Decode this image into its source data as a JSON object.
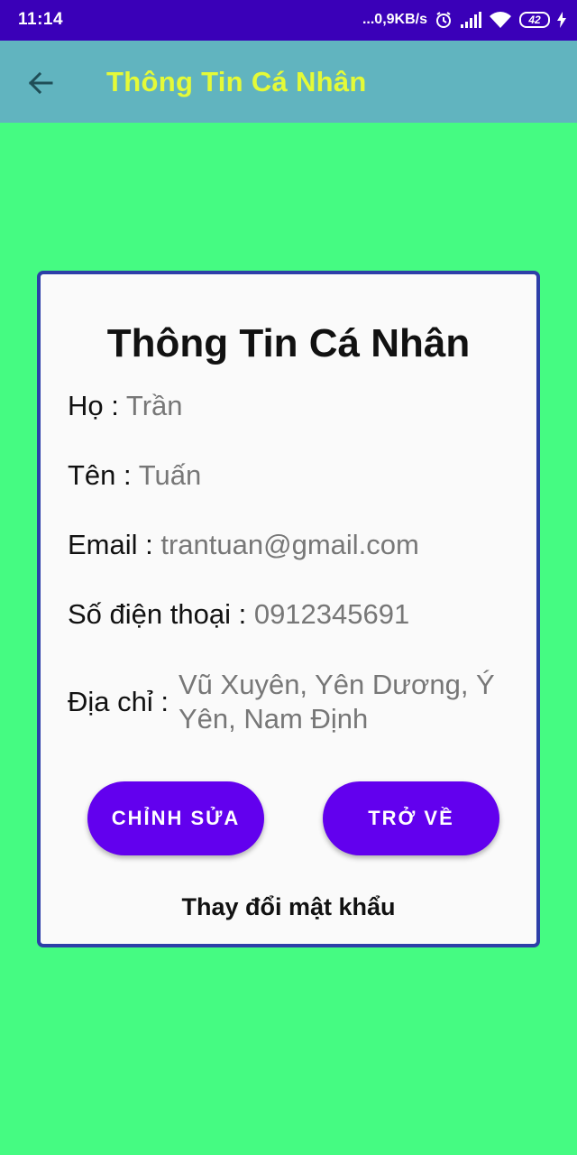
{
  "status_bar": {
    "time": "11:14",
    "network_speed": "...0,9KB/s",
    "battery_level": "42",
    "icons": [
      "alarm-icon",
      "signal-icon",
      "wifi-icon",
      "battery-icon",
      "charging-icon"
    ]
  },
  "app_bar": {
    "title": "Thông Tin Cá Nhân",
    "back_icon": "arrow-left-icon",
    "background": "#61b4bf",
    "title_color": "#e4fa38"
  },
  "card": {
    "title": "Thông Tin Cá Nhân",
    "fields": {
      "last_name": {
        "label": "Họ : ",
        "value": "Trần"
      },
      "first_name": {
        "label": "Tên : ",
        "value": "Tuấn"
      },
      "email": {
        "label": "Email : ",
        "value": "trantuan@gmail.com"
      },
      "phone": {
        "label": "Số điện thoại : ",
        "value": "0912345691"
      },
      "address": {
        "label": "Địa chỉ :",
        "value": "Vũ Xuyên, Yên Dương, Ý Yên, Nam Định"
      }
    },
    "buttons": {
      "edit": "CHỈNH SỬA",
      "back": "TRỞ VỀ"
    },
    "change_password": "Thay đổi mật khẩu",
    "border_color": "#2d3fa8"
  },
  "colors": {
    "page_background": "#45fb82",
    "status_bar": "#3a00b8",
    "button": "#6200ee"
  }
}
